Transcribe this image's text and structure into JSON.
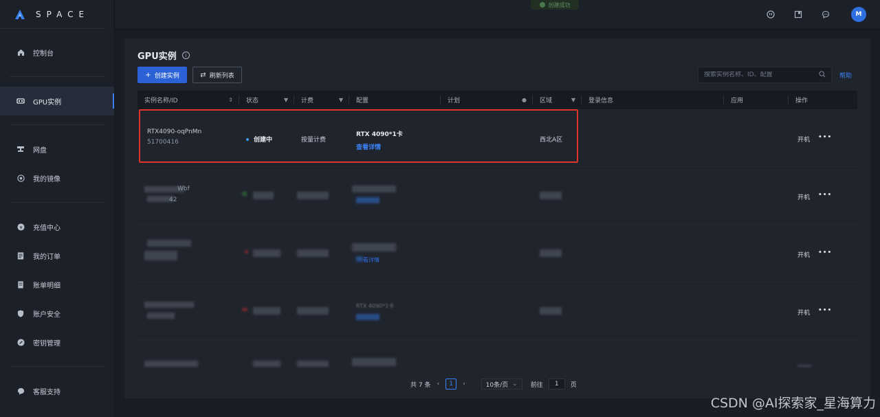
{
  "brand": {
    "logo_text": "SPACE"
  },
  "sidebar": {
    "groups": [
      [
        {
          "label": "控制台",
          "icon": "home-icon"
        }
      ],
      [
        {
          "label": "GPU实例",
          "icon": "gpu-icon",
          "active": true
        }
      ],
      [
        {
          "label": "网盘",
          "icon": "disk-icon"
        },
        {
          "label": "我的镜像",
          "icon": "image-icon"
        }
      ],
      [
        {
          "label": "充值中心",
          "icon": "yen-icon"
        },
        {
          "label": "我的订单",
          "icon": "order-icon"
        },
        {
          "label": "账单明细",
          "icon": "bill-icon"
        },
        {
          "label": "账户安全",
          "icon": "shield-icon"
        },
        {
          "label": "密钥管理",
          "icon": "key-icon"
        }
      ],
      [
        {
          "label": "客服支持",
          "icon": "chat-icon"
        }
      ]
    ]
  },
  "topbar": {
    "toast": "创建成功",
    "avatar_initial": "M"
  },
  "main": {
    "title": "GPU实例",
    "create_button": "创建实例",
    "refresh_button": "刷新列表",
    "search_placeholder": "搜索实例名称、ID、配置",
    "help_link": "帮助",
    "columns": [
      "实例名称/ID",
      "状态",
      "计费",
      "配置",
      "计划",
      "区域",
      "登录信息",
      "应用",
      "操作"
    ],
    "rows": [
      {
        "name": "RTX4090-oqPnMn",
        "id": "51700416",
        "status": "创建中",
        "billing": "按量计费",
        "config": "RTX 4090*1卡",
        "detail_link": "查看详情",
        "region": "西北A区",
        "action": "开机",
        "more": "•••"
      },
      {
        "partial_name": "Wbf",
        "partial_id": "42",
        "action": "开机",
        "more": "•••"
      },
      {
        "partial_link": "看详情",
        "action": "开机",
        "more": "•••"
      },
      {
        "partial_config": "RTX 4090*1卡",
        "action": "开机",
        "more": "•••"
      },
      {
        "action": "",
        "more": ""
      }
    ]
  },
  "pagination": {
    "total": "共 7 条",
    "current_page": "1",
    "page_size": "10条/页",
    "goto_label": "前往",
    "goto_value": "1",
    "page_unit": "页"
  },
  "watermark": "CSDN @AI探索家_星海算力",
  "colors": {
    "accent": "#3b82f6",
    "highlight": "#e0352b",
    "status_dot": "#3b9cf6"
  }
}
